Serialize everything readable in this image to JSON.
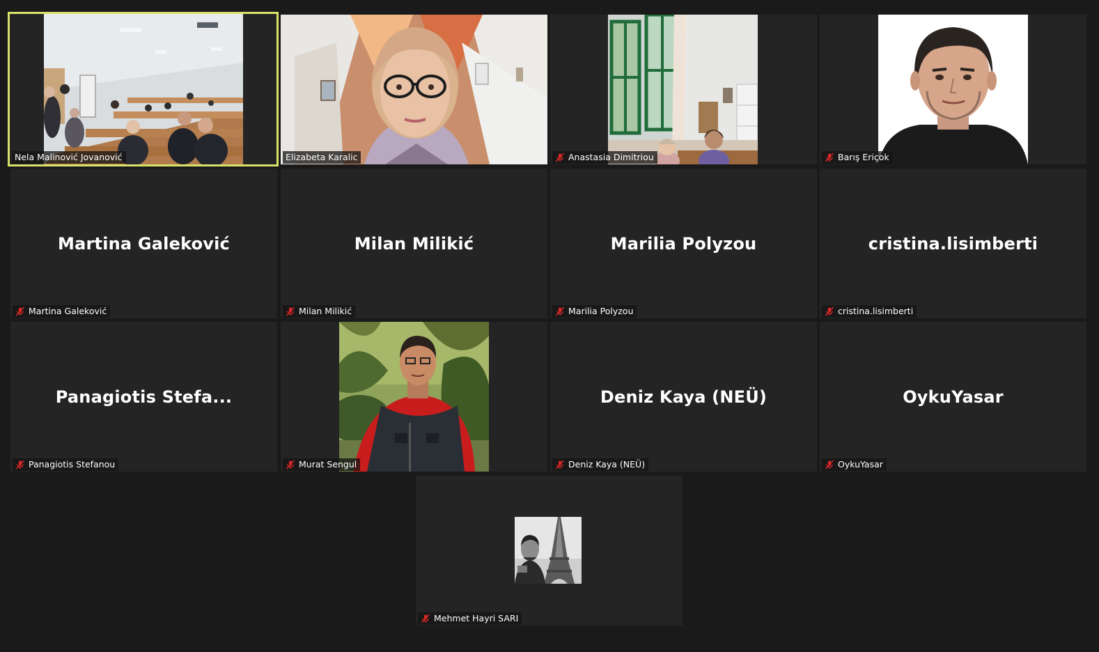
{
  "gallery": {
    "participants": [
      {
        "display_name": "Nela Malinović Jovanović",
        "muted": false,
        "active_speaker": true,
        "video": "classroom-video"
      },
      {
        "display_name": "Elizabeta Karalic",
        "muted": false,
        "active_speaker": false,
        "video": "woman-glasses-video"
      },
      {
        "display_name": "Anastasia Dimitriou",
        "muted": true,
        "active_speaker": false,
        "video": "room-window-video"
      },
      {
        "display_name": "Barış Eriçok",
        "muted": true,
        "active_speaker": false,
        "video": "man-portrait-photo"
      },
      {
        "display_name": "Martina Galeković",
        "center_label": "Martina Galeković",
        "muted": true,
        "video": null
      },
      {
        "display_name": "Milan Milikić",
        "center_label": "Milan Milikić",
        "muted": true,
        "video": null
      },
      {
        "display_name": "Marilia Polyzou",
        "center_label": "Marilia Polyzou",
        "muted": true,
        "video": null
      },
      {
        "display_name": "cristina.lisimberti",
        "center_label": "cristina.lisimberti",
        "muted": true,
        "video": null
      },
      {
        "display_name": "Panagiotis Stefanou",
        "center_label": "Panagiotis  Stefa...",
        "muted": true,
        "video": null
      },
      {
        "display_name": "Murat Sengul",
        "muted": true,
        "video": "man-outdoor-photo"
      },
      {
        "display_name": "Deniz Kaya (NEÜ)",
        "center_label": "Deniz Kaya (NEÜ)",
        "muted": true,
        "video": null
      },
      {
        "display_name": "OykuYasar",
        "center_label": "OykuYasar",
        "muted": true,
        "video": null
      },
      {
        "display_name": "Mehmet Hayri SARI",
        "muted": true,
        "video": "eiffel-avatar-photo"
      }
    ]
  },
  "colors": {
    "background": "#1a1a1a",
    "tile": "#242424",
    "active_border": "#d8e26a",
    "muted_icon": "#e02828",
    "text": "#ffffff"
  },
  "icons": {
    "muted": "microphone-muted-icon"
  }
}
